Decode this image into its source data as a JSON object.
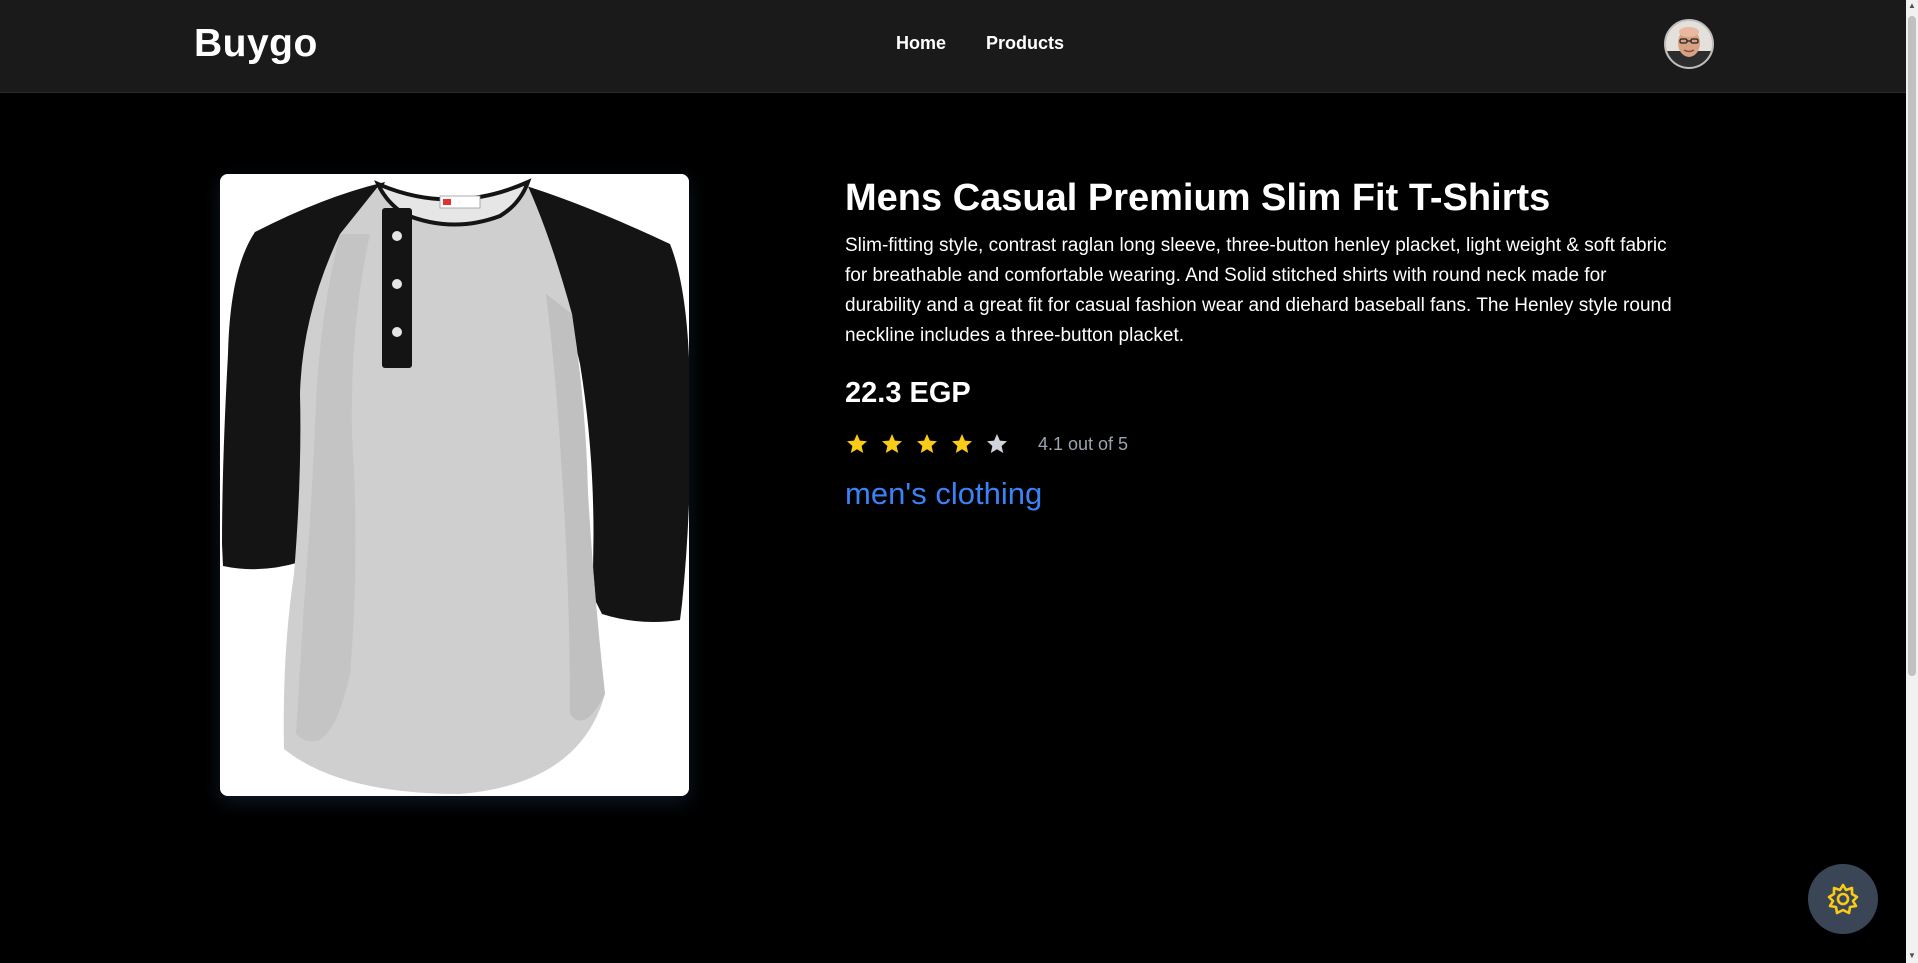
{
  "header": {
    "brand": "Buygo",
    "nav": [
      "Home",
      "Products"
    ]
  },
  "product": {
    "title": "Mens Casual Premium Slim Fit T-Shirts",
    "description": "Slim-fitting style, contrast raglan long sleeve, three-button henley placket, light weight & soft fabric for breathable and comfortable wearing. And Solid stitched shirts with round neck made for durability and a great fit for casual fashion wear and diehard baseball fans. The Henley style round neckline includes a three-button placket.",
    "price": "22.3 EGP",
    "rating": 4.1,
    "rating_text": "4.1 out of 5",
    "category": "men's clothing"
  },
  "colors": {
    "star_filled": "#facc15",
    "star_empty": "#d1d5db",
    "category_link": "#3b82f6",
    "navbar_bg": "#1a1a1a",
    "page_bg": "#000000"
  },
  "icons": {
    "settings": "sun-gear-icon",
    "avatar": "user-avatar"
  }
}
